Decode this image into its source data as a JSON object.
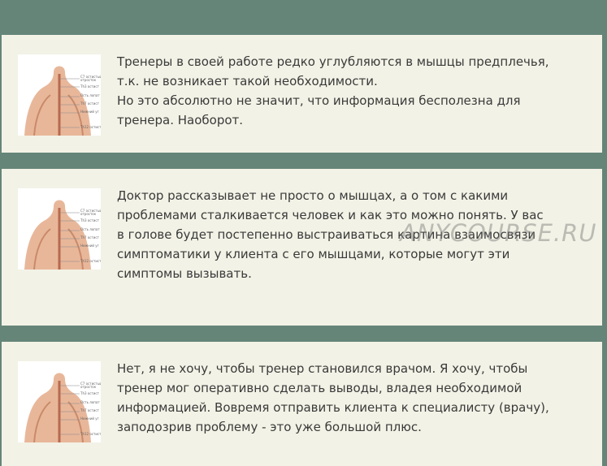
{
  "cards": [
    {
      "lines": [
        "Тренеры в своей работе редко углубляются в мышцы предплечья,",
        "т.к. не возникает такой необходимости.",
        "Но это абсолютно не значит, что информация бесполезна для",
        "тренера. Наоборот."
      ]
    },
    {
      "lines": [
        "Доктор рассказывает не просто о мышцах, а о том с какими",
        "проблемами сталкивается человек и как это можно понять. У вас",
        "в голове будет постепенно выстраиваться картина взаимосвязи",
        "симптоматики у клиента с его мышцами, которые могут эти",
        "симптомы вызывать."
      ]
    },
    {
      "lines": [
        "Нет, я не хочу, чтобы тренер становился врачом. Я хочу, чтобы",
        "тренер мог оперативно сделать выводы, владея необходимой",
        "информацией. Вовремя отправить клиента к специалисту (врачу),",
        "заподозрив проблему - это уже большой плюс."
      ]
    }
  ],
  "watermark": "ANYCOURSE.RU"
}
